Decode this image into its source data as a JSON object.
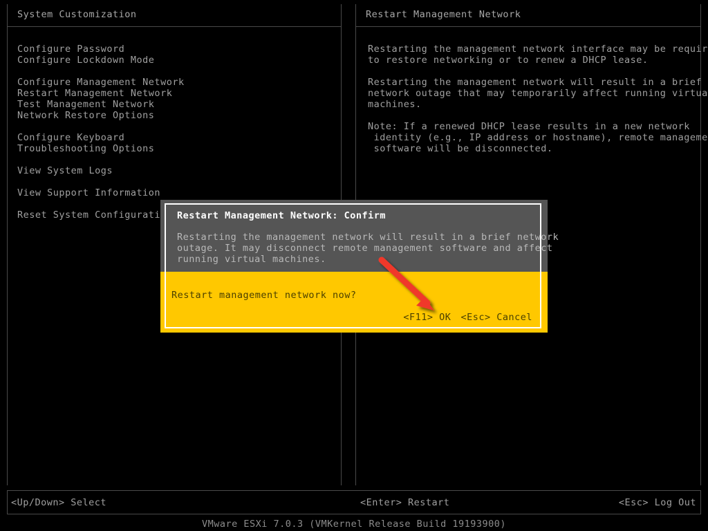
{
  "header": {
    "left_title": "System Customization",
    "right_title": "Restart Management Network"
  },
  "menu": {
    "groups": [
      {
        "items": [
          "Configure Password",
          "Configure Lockdown Mode"
        ]
      },
      {
        "items": [
          "Configure Management Network",
          "Restart Management Network",
          "Test Management Network",
          "Network Restore Options"
        ]
      },
      {
        "items": [
          "Configure Keyboard",
          "Troubleshooting Options"
        ]
      },
      {
        "items": [
          "View System Logs"
        ]
      },
      {
        "items": [
          "View Support Information"
        ]
      },
      {
        "items": [
          "Reset System Configuration"
        ]
      }
    ]
  },
  "description": {
    "paragraphs": [
      [
        "Restarting the management network interface may be required",
        "to restore networking or to renew a DHCP lease."
      ],
      [
        "Restarting the management network will result in a brief",
        "network outage that may temporarily affect running virtual",
        "machines."
      ],
      [
        "Note: If a renewed DHCP lease results in a new network",
        " identity (e.g., IP address or hostname), remote management",
        " software will be disconnected."
      ]
    ]
  },
  "dialog": {
    "title": "Restart Management Network: Confirm",
    "body_lines": [
      "Restarting the management network will result in a brief network",
      "outage. It may disconnect remote management software and affect",
      "running virtual machines."
    ],
    "question": "Restart management network now?",
    "actions": [
      {
        "key": "<F11>",
        "label": "OK"
      },
      {
        "key": "<Esc>",
        "label": "Cancel"
      }
    ]
  },
  "status_bar": {
    "left": "<Up/Down> Select",
    "center": "<Enter> Restart",
    "right": "<Esc> Log Out"
  },
  "version": "VMware ESXi 7.0.3 (VMKernel Release Build 19193900)",
  "colors": {
    "background": "#000000",
    "text": "#a0a0a0",
    "border": "#4a4a4a",
    "dialog_gray": "#555555",
    "dialog_yellow": "#ffc800",
    "dialog_border": "#ffffff",
    "annotation_red": "#f0392b"
  },
  "annotation": {
    "type": "arrow",
    "points_to": "<F11> OK"
  }
}
